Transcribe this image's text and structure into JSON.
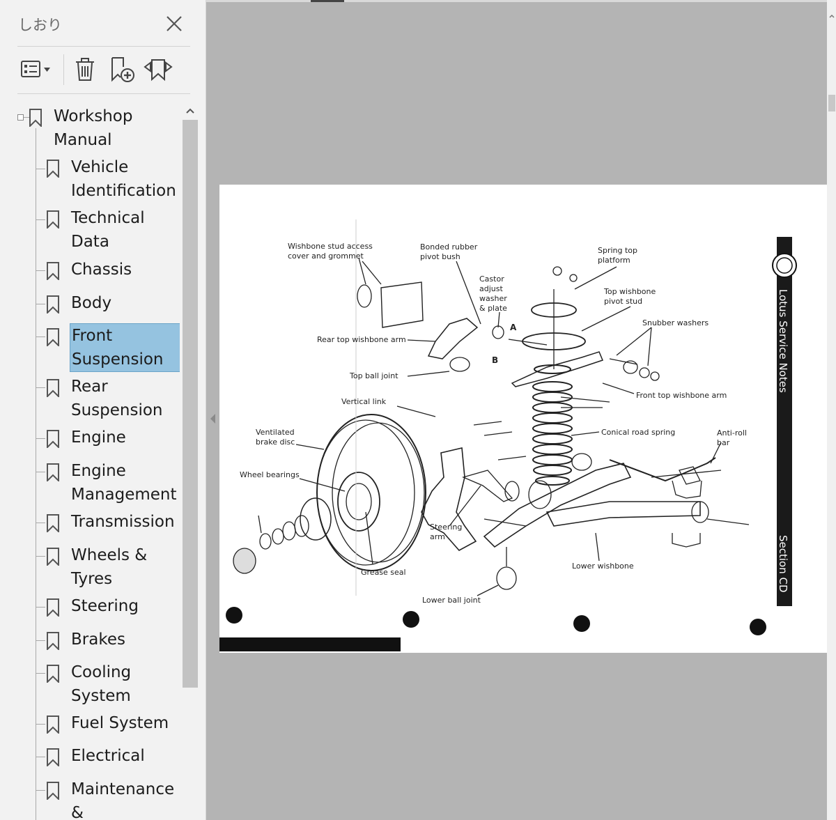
{
  "panel": {
    "title": "しおり",
    "bookmarks": [
      {
        "label": "Workshop\nManual"
      },
      {
        "label": "Vehicle\nIdentification"
      },
      {
        "label": "Technical\nData"
      },
      {
        "label": "Chassis"
      },
      {
        "label": "Body"
      },
      {
        "label": "Front\nSuspension",
        "selected": true
      },
      {
        "label": "Rear\nSuspension"
      },
      {
        "label": "Engine"
      },
      {
        "label": "Engine\nManagement"
      },
      {
        "label": "Transmission"
      },
      {
        "label": "Wheels &\nTyres"
      },
      {
        "label": "Steering"
      },
      {
        "label": "Brakes"
      },
      {
        "label": "Cooling\nSystem"
      },
      {
        "label": "Fuel System"
      },
      {
        "label": "Electrical"
      },
      {
        "label": "Maintenance\n& Lubrication"
      }
    ]
  },
  "document": {
    "sidebar_text_top": "Lotus Service Notes",
    "sidebar_text_bottom": "Section CD",
    "labels": {
      "wishbone_stud": "Wishbone stud access\ncover and grommet",
      "bonded_rubber": "Bonded rubber\npivot bush",
      "spring_top": "Spring top\nplatform",
      "castor": "Castor\nadjust\nwasher\n& plate",
      "top_wishbone_stud": "Top wishbone\npivot stud",
      "snubber": "Snubber washers",
      "rear_top_arm": "Rear top wishbone arm",
      "top_ball_joint": "Top ball joint",
      "front_top_arm": "Front top wishbone arm",
      "vertical_link": "Vertical link",
      "ventilated_disc": "Ventilated\nbrake disc",
      "conical_spring": "Conical road spring",
      "anti_roll": "Anti-roll\nbar",
      "wheel_bearings": "Wheel bearings",
      "steering_arm": "Steering\narm",
      "lower_wishbone": "Lower wishbone",
      "grease_seal": "Grease seal",
      "lower_ball_joint": "Lower ball joint",
      "callout_a": "A",
      "callout_b": "B"
    }
  },
  "colors": {
    "selection": "#95c3e0",
    "panel_bg": "#f2f2f2",
    "viewer_bg": "#b4b4b4"
  }
}
